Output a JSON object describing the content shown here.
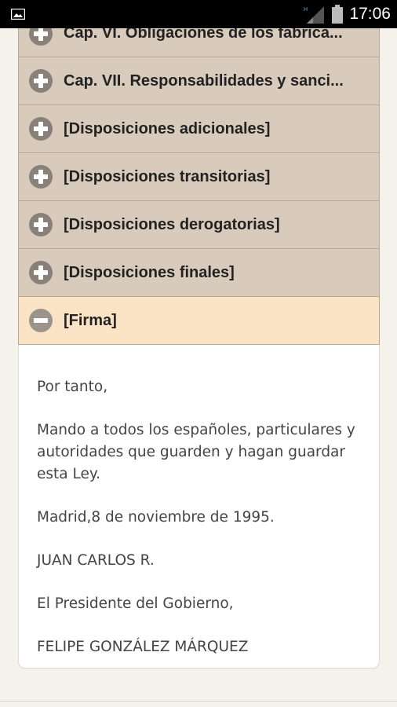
{
  "status_bar": {
    "time": "17:06",
    "icons": [
      "image-notification-icon",
      "signal-icon",
      "battery-icon"
    ]
  },
  "accordion": {
    "sections": [
      {
        "label": "Cap. VI. Obligaciones de los fabrica...",
        "state": "collapsed",
        "icon": "plus-circle-icon"
      },
      {
        "label": "Cap. VII. Responsabilidades y sanci...",
        "state": "collapsed",
        "icon": "plus-circle-icon"
      },
      {
        "label": "[Disposiciones adicionales]",
        "state": "collapsed",
        "icon": "plus-circle-icon"
      },
      {
        "label": "[Disposiciones transitorias]",
        "state": "collapsed",
        "icon": "plus-circle-icon"
      },
      {
        "label": "[Disposiciones derogatorias]",
        "state": "collapsed",
        "icon": "plus-circle-icon"
      },
      {
        "label": "[Disposiciones finales]",
        "state": "collapsed",
        "icon": "plus-circle-icon"
      },
      {
        "label": "[Firma]",
        "state": "expanded",
        "icon": "minus-circle-icon"
      }
    ],
    "open_body": {
      "paragraphs": [
        "Por tanto,",
        "Mando a todos los españoles, particulares y autoridades que guarden y hagan guardar esta Ley.",
        "Madrid,8 de noviembre de 1995.",
        "JUAN CARLOS R.",
        "El Presidente del Gobierno,",
        "FELIPE GONZÁLEZ MÁRQUEZ"
      ]
    }
  },
  "colors": {
    "header_collapsed": "#d9cbbb",
    "header_expanded": "#fbe3c6",
    "icon": "#888079",
    "page_bg": "#f5f2ec"
  }
}
